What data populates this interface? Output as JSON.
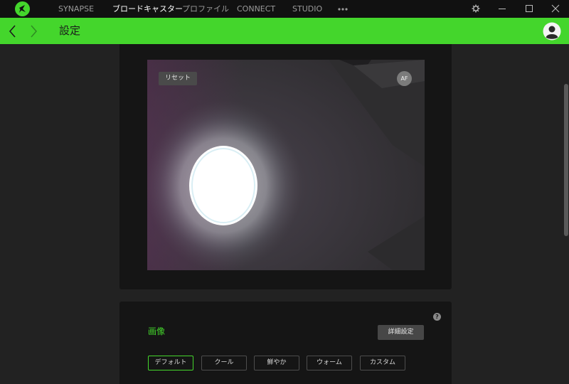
{
  "nav": {
    "items": [
      {
        "label": "SYNAPSE",
        "active": false
      },
      {
        "label": "ブロードキャスター",
        "active": true
      },
      {
        "label": "プロファイル",
        "active": false
      },
      {
        "label": "CONNECT",
        "active": false
      },
      {
        "label": "STUDIO",
        "active": false
      }
    ],
    "more_icon": "more-dots-icon",
    "window_controls": [
      "gear-icon",
      "minimize-icon",
      "maximize-icon",
      "close-icon"
    ]
  },
  "header": {
    "title": "設定",
    "back_icon": "chevron-left-icon",
    "forward_icon": "chevron-right-icon",
    "avatar_icon": "user-avatar-icon"
  },
  "preview": {
    "reset_label": "リセット",
    "af_label": "AF"
  },
  "image_settings": {
    "title": "画像",
    "advanced_label": "詳細設定",
    "help_icon": "question-mark-icon",
    "presets": [
      "デフォルト",
      "クール",
      "鮮やか",
      "ウォーム",
      "カスタム"
    ],
    "selected_preset": "デフォルト"
  },
  "colors": {
    "accent": "#44d62c",
    "topbar": "#111111",
    "background": "#222222",
    "card": "#151515"
  }
}
